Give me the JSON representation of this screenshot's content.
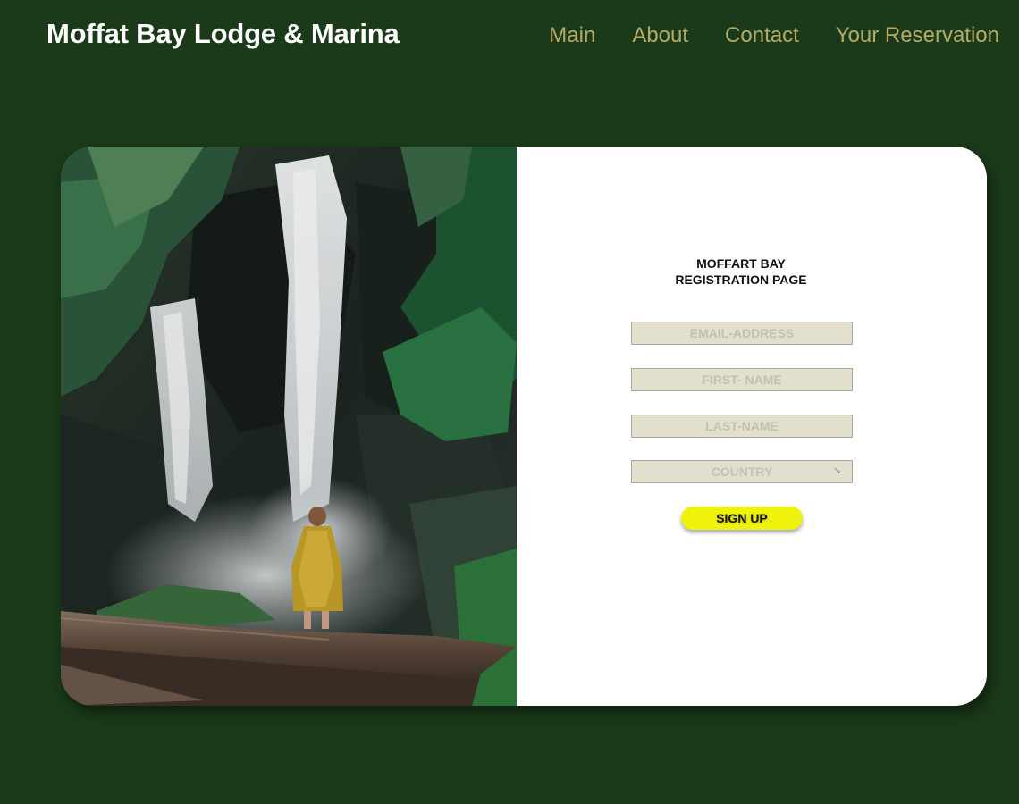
{
  "header": {
    "site_title": "Moffat Bay Lodge & Marina",
    "nav": [
      {
        "label": "Main"
      },
      {
        "label": "About"
      },
      {
        "label": "Contact"
      },
      {
        "label": "Your Reservation"
      }
    ]
  },
  "registration": {
    "title_line1": "MOFFART BAY",
    "title_line2": "REGISTRATION PAGE",
    "email": {
      "placeholder": "EMAIL-ADDRESS",
      "value": ""
    },
    "first_name": {
      "placeholder": "FIRST- NAME",
      "value": ""
    },
    "last_name": {
      "placeholder": "LAST-NAME",
      "value": ""
    },
    "country": {
      "selected": "COUNTRY",
      "arrow": "↘"
    },
    "signup_label": "SIGN UP"
  },
  "photo": {
    "icon": "waterfall-photo"
  },
  "colors": {
    "background": "#1a3a19",
    "nav_text": "#b5ab68",
    "button": "#eff20c",
    "field_bg": "#e2e0cd"
  }
}
